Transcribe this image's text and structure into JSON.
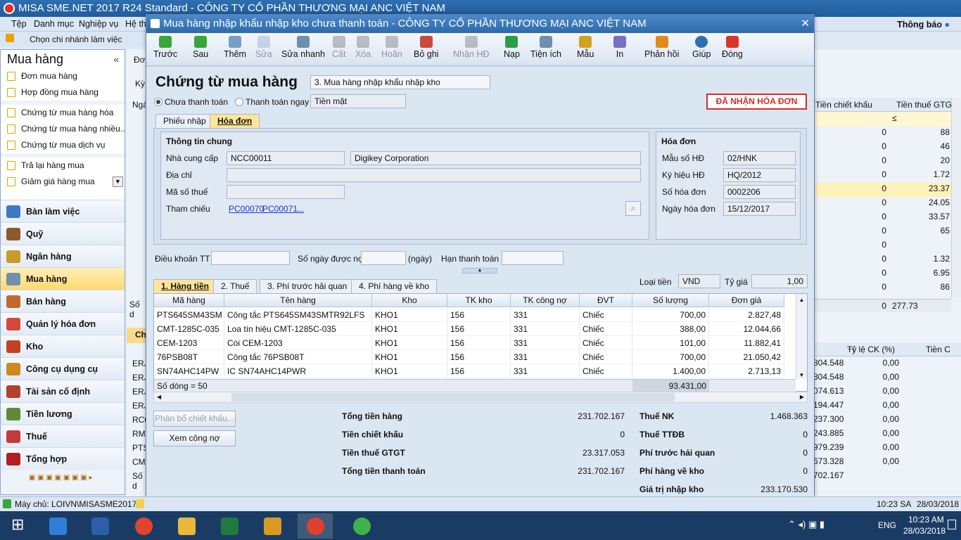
{
  "app": {
    "title": "MISA SME.NET 2017 R24 Standard - CÔNG TY CỔ PHẦN THƯƠNG MẠI ANC VIỆT NAM",
    "menu": [
      "Tệp",
      "Danh mục",
      "Nghiệp vụ",
      "Hệ th"
    ],
    "branch": "Chọn chi nhánh làm việc",
    "notify": "Thông báo"
  },
  "sidebar": {
    "title": "Mua hàng",
    "subitems": [
      "Đơn mua hàng",
      "Hợp đồng mua hàng",
      "Chứng từ mua hàng hóa",
      "Chứng từ mua hàng nhiều...",
      "Chứng từ mua dịch vụ",
      "Trả lại hàng mua",
      "Giảm giá hàng mua"
    ],
    "modules": [
      "Bàn làm việc",
      "Quỹ",
      "Ngân hàng",
      "Mua hàng",
      "Bán hàng",
      "Quản lý hóa đơn",
      "Kho",
      "Công cụ dụng cụ",
      "Tài sản cố định",
      "Tiền lương",
      "Thuế",
      "Tổng hợp"
    ]
  },
  "bg": {
    "col1": "Tiền chiết khấu",
    "col2": "Tiền thuế GTG",
    "zeros": [
      "0",
      "0",
      "0",
      "0",
      "0",
      "0",
      "0",
      "0",
      "0",
      "0",
      "0",
      "0",
      "0"
    ],
    "vat": [
      "88",
      "46",
      "20",
      "1.72",
      "23.37",
      "24.05",
      "33.57",
      "65",
      "",
      "1.32",
      "6.95",
      "86"
    ],
    "sum": "0",
    "sumvat": "277.73",
    "h2": "Tỷ lệ CK (%)",
    "h3": "Tiền C",
    "lower_left": [
      "ERJ",
      "ERJ",
      "ERJ",
      "ERJ",
      "RC0",
      "RMC",
      "PTS",
      "CMT",
      "Số d"
    ],
    "lower_amt": [
      "804.548",
      "804.548",
      "074.613",
      "194.447",
      "237.300",
      "243.885",
      "979.239",
      "673.328",
      "702.167"
    ],
    "lower_rate": [
      "0,00",
      "0,00",
      "0,00",
      "0,00",
      "0,00",
      "0,00",
      "0,00",
      "0,00"
    ],
    "left_labels": [
      "Đơn",
      "Kỳ",
      "Ngà",
      "Số d",
      "Ch"
    ]
  },
  "dialog": {
    "title": "Mua hàng nhập khẩu nhập kho chưa thanh toán - CÔNG TY CỔ PHẦN THƯƠNG MẠI ANC VIỆT NAM",
    "toolbar": {
      "back": "Trước",
      "next": "Sau",
      "add": "Thêm",
      "edit": "Sửa",
      "quick_edit": "Sửa nhanh",
      "save": "Cất",
      "delete": "Xóa",
      "undo": "Hoãn",
      "unpost": "Bỏ ghi",
      "invoice": "Nhận HĐ",
      "load": "Nạp",
      "utility": "Tiện ích",
      "template": "Mẫu",
      "print": "In",
      "feedback": "Phản hồi",
      "help": "Giúp",
      "close": "Đóng"
    },
    "heading": "Chứng từ mua hàng",
    "type": "3. Mua hàng nhập khẩu nhập kho",
    "unpaid": "Chưa thanh toán",
    "paid": "Thanh toán ngay",
    "paymethod": "Tiền mặt",
    "badge": "ĐÃ NHẬN HÓA ĐƠN",
    "tab_receipt": "Phiếu nhập",
    "tab_invoice": "Hóa đơn",
    "general": {
      "title": "Thông tin chung",
      "supplier_l": "Nhà cung cấp",
      "supplier_code": "NCC00011",
      "supplier_name": "Digikey Corporation",
      "address_l": "Địa chỉ",
      "tax_l": "Mã số thuế",
      "ref_l": "Tham chiếu",
      "ref1": "PC00070",
      "ref2": "PC00071",
      "ref3": "..."
    },
    "invoice": {
      "title": "Hóa đơn",
      "form_l": "Mẫu số HĐ",
      "form": "02/HNK",
      "serial_l": "Ký hiệu HĐ",
      "serial": "HQ/2012",
      "no_l": "Số hóa đơn",
      "no": "0002206",
      "date_l": "Ngày hóa đơn",
      "date": "15/12/2017"
    },
    "terms_l": "Điều khoản TT",
    "days_l": "Số ngày được nợ",
    "days_u": "(ngày)",
    "due_l": "Hạn thanh toán",
    "tabs": [
      "1. Hàng tiền",
      "2. Thuế",
      "3. Phí trước hải quan",
      "4. Phí hàng về kho"
    ],
    "currency_l": "Loại tiền",
    "currency": "VND",
    "rate_l": "Tỷ giá",
    "rate": "1,00",
    "cols": [
      "Mã hàng",
      "Tên hàng",
      "Kho",
      "TK kho",
      "TK công nợ",
      "ĐVT",
      "Số lượng",
      "Đơn giá"
    ],
    "rows": [
      [
        "PTS645SM43SM",
        "Công tắc PTS645SM43SMTR92LFS",
        "KHO1",
        "156",
        "331",
        "Chiếc",
        "700,00",
        "2.827,48"
      ],
      [
        "CMT-1285C-035",
        "Loa tín hiệu CMT-1285C-035",
        "KHO1",
        "156",
        "331",
        "Chiếc",
        "388,00",
        "12.044,66"
      ],
      [
        "CEM-1203",
        "Còi CEM-1203",
        "KHO1",
        "156",
        "331",
        "Chiếc",
        "101,00",
        "11.882,41"
      ],
      [
        "76PSB08T",
        "Công tắc 76PSB08T",
        "KHO1",
        "156",
        "331",
        "Chiếc",
        "700,00",
        "21.050,42"
      ],
      [
        "SN74AHC14PW",
        "IC SN74AHC14PWR",
        "KHO1",
        "156",
        "331",
        "Chiếc",
        "1.400,00",
        "2.713,13"
      ]
    ],
    "row_count": "Số dòng = 50",
    "sum_qty": "93.431,00",
    "btn_alloc": "Phân bổ chiết khấu...",
    "btn_debt": "Xem công nợ",
    "totals": {
      "goods_l": "Tổng tiền hàng",
      "goods": "231.702.167",
      "disc_l": "Tiền chiết khấu",
      "disc": "0",
      "vat_l": "Tiền thuế GTGT",
      "vat": "23.317.053",
      "pay_l": "Tổng tiền thanh toán",
      "pay": "231.702.167",
      "nk_l": "Thuế NK",
      "nk": "1.468.363",
      "ttdb_l": "Thuế TTĐB",
      "ttdb": "0",
      "customs_l": "Phí trước hải quan",
      "customs": "0",
      "ship_l": "Phí hàng về kho",
      "ship": "0",
      "value_l": "Giá trị nhập kho",
      "value": "233.170.530"
    }
  },
  "status": {
    "server": "Máy chủ: LOIVN\\MISASME2017",
    "time": "10:23 SA",
    "date": "28/03/2018"
  },
  "taskbar": {
    "lang": "ENG",
    "time": "10:23 AM",
    "date": "28/03/2018"
  }
}
